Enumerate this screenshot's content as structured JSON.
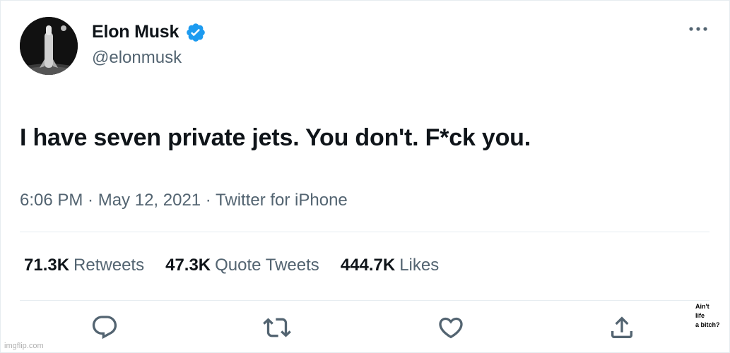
{
  "tweet": {
    "author_name": "Elon Musk",
    "handle": "@elonmusk",
    "text": "I have seven private jets. You don't. F*ck you.",
    "meta": "6:06 PM · May 12, 2021 · Twitter for iPhone",
    "verified": true
  },
  "stats": [
    {
      "value": "71.3K",
      "label": "Retweets"
    },
    {
      "value": "47.3K",
      "label": "Quote Tweets"
    },
    {
      "value": "444.7K",
      "label": "Likes"
    }
  ],
  "actions": [
    "reply-icon",
    "retweet-icon",
    "heart-icon",
    "share-icon"
  ],
  "overlay_caption": [
    "Ain't",
    "life",
    "a bitch?"
  ],
  "watermark": "imgflip.com",
  "colors": {
    "text": "#0f1419",
    "secondary": "#536471",
    "verified_blue": "#1d9bf0",
    "divider": "#e6ecf0"
  }
}
